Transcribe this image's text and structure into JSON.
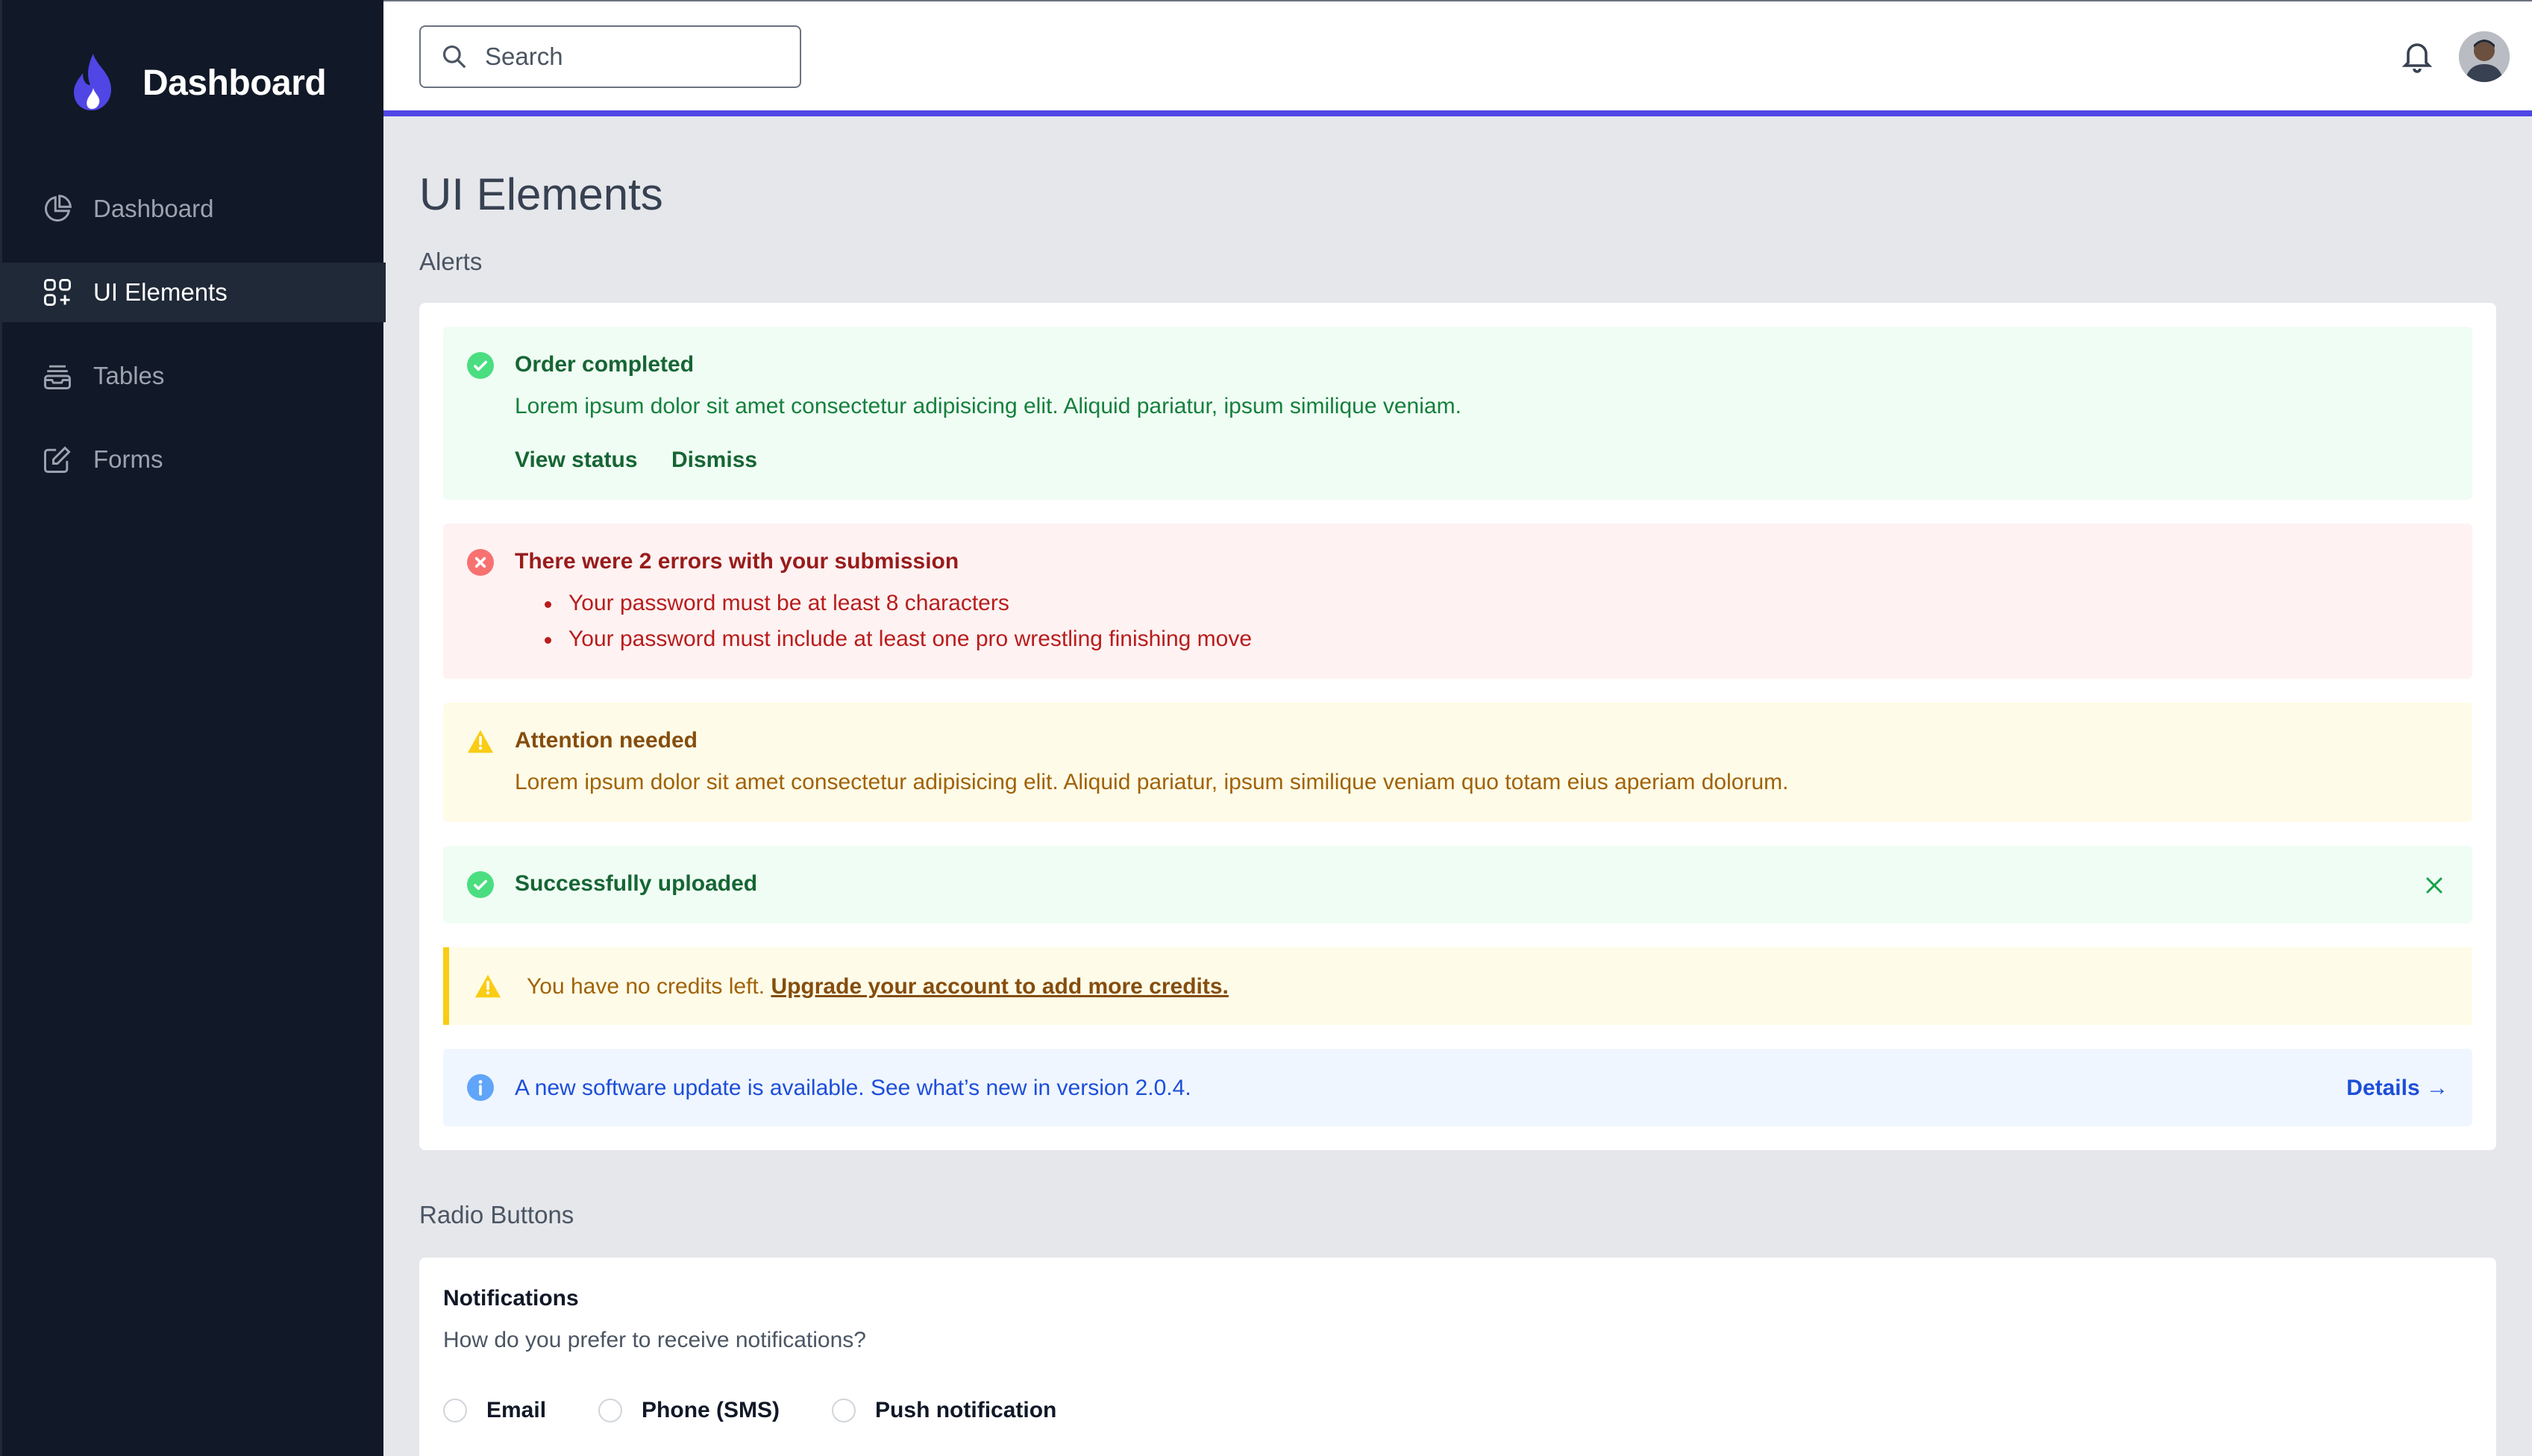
{
  "sidebar": {
    "brand": "Dashboard",
    "items": [
      {
        "label": "Dashboard",
        "icon": "pie-chart-icon",
        "active": false
      },
      {
        "label": "UI Elements",
        "icon": "squares-plus-icon",
        "active": true
      },
      {
        "label": "Tables",
        "icon": "inbox-stack-icon",
        "active": false
      },
      {
        "label": "Forms",
        "icon": "pencil-square-icon",
        "active": false
      }
    ]
  },
  "header": {
    "search_placeholder": "Search"
  },
  "page": {
    "title": "UI Elements",
    "alerts_label": "Alerts",
    "radio_label": "Radio Buttons"
  },
  "alerts": {
    "order": {
      "title": "Order completed",
      "body": "Lorem ipsum dolor sit amet consectetur adipisicing elit. Aliquid pariatur, ipsum similique veniam.",
      "view_status": "View status",
      "dismiss": "Dismiss"
    },
    "errors": {
      "title": "There were 2 errors with your submission",
      "items": [
        "Your password must be at least 8 characters",
        "Your password must include at least one pro wrestling finishing move"
      ]
    },
    "attention": {
      "title": "Attention needed",
      "body": "Lorem ipsum dolor sit amet consectetur adipisicing elit. Aliquid pariatur, ipsum similique veniam quo totam eius aperiam dolorum."
    },
    "uploaded": {
      "title": "Successfully uploaded"
    },
    "credits": {
      "text": "You have no credits left. ",
      "link": "Upgrade your account to add more credits."
    },
    "update": {
      "text": "A new software update is available. See what’s new in version 2.0.4.",
      "details": "Details →"
    }
  },
  "radios": {
    "title": "Notifications",
    "subtitle": "How do you prefer to receive notifications?",
    "options": [
      "Email",
      "Phone (SMS)",
      "Push notification"
    ]
  },
  "colors": {
    "accent": "#4f46e5",
    "sidebar_bg": "#111827",
    "success": "#4ade80",
    "error": "#f87171",
    "warning": "#facc15",
    "info": "#60a5fa"
  }
}
